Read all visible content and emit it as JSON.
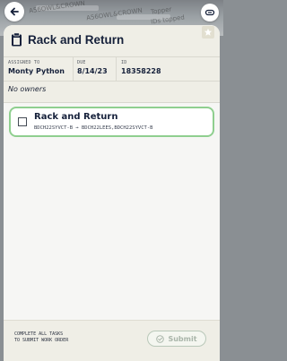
{
  "backdrop": {
    "text_1": "A56OWL&CROWN",
    "text_2": "Topper",
    "text_3": "IDs topped"
  },
  "header": {
    "title": "Rack and Return"
  },
  "meta": {
    "assigned_label": "ASSIGNED TO",
    "assigned_value": "Monty Python",
    "due_label": "DUE",
    "due_value": "8/14/23",
    "id_label": "ID",
    "id_value": "18358228"
  },
  "owners_text": "No owners",
  "task": {
    "title": "Rack and Return",
    "from": "BDCH22SYVCT-B",
    "arrow": "→",
    "to": "BDCH22LEES,BDCH22SYVCT-B",
    "completed": false
  },
  "footer": {
    "note_line_1": "COMPLETE ALL TASKS",
    "note_line_2": "TO SUBMIT WORK ORDER",
    "submit_label": "Submit",
    "submit_enabled": false
  },
  "colors": {
    "title": "#16213b",
    "task_border": "#8fcf8f",
    "submit_disabled": "#a9b5a9"
  },
  "icons": {
    "back": "arrow-left-icon",
    "top_right": "link-icon",
    "title": "clipboard-icon",
    "bookmark": "star-icon",
    "submit": "check-circle-icon"
  }
}
